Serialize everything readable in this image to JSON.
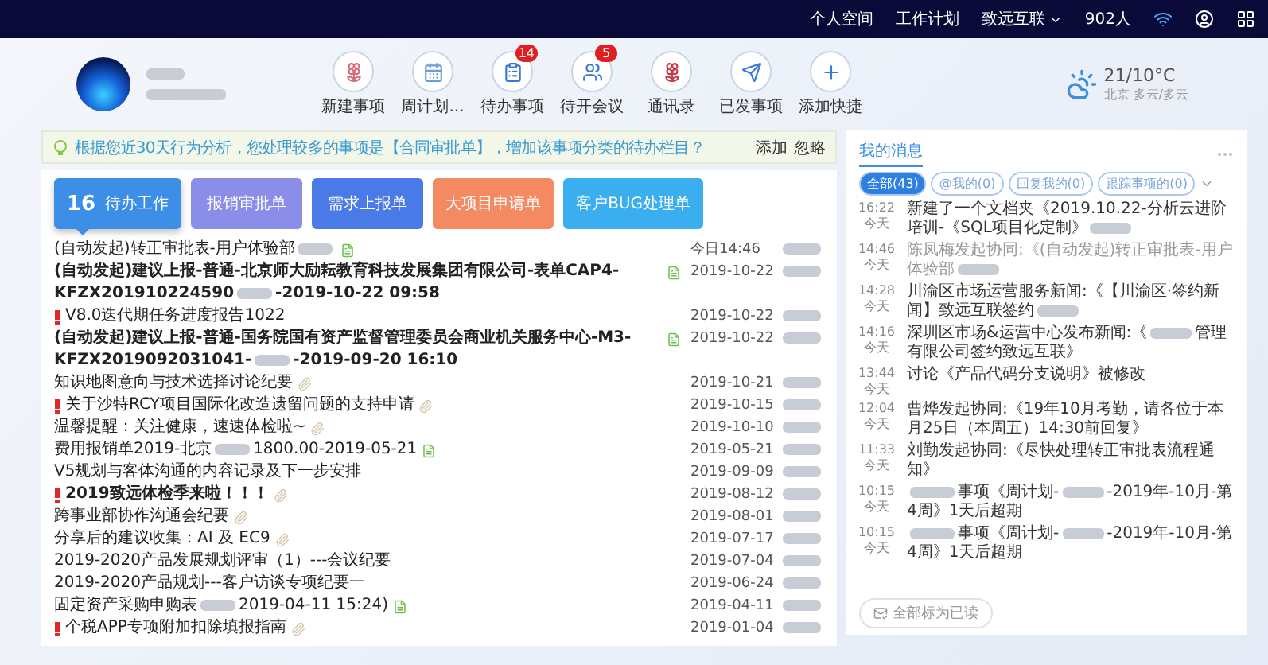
{
  "top_nav": {
    "links": [
      {
        "label": "个人空间",
        "dropdown": false
      },
      {
        "label": "工作计划",
        "dropdown": false
      },
      {
        "label": "致远互联",
        "dropdown": true
      }
    ],
    "online_count": "902人"
  },
  "profile": {
    "shortcuts": [
      {
        "label": "新建事项"
      },
      {
        "label": "周计划..."
      },
      {
        "label": "待办事项",
        "badge": "14"
      },
      {
        "label": "待开会议",
        "badge": "5"
      },
      {
        "label": "通讯录"
      },
      {
        "label": "已发事项"
      },
      {
        "label": "添加快捷"
      }
    ]
  },
  "weather": {
    "temperature": "21/10°C",
    "place": "北京 多云/多云"
  },
  "suggestion": {
    "text": "根据您近30天行为分析，您处理较多的事项是【合同审批单】，增加该事项分类的待办栏目？",
    "actions": [
      "添加",
      "忽略"
    ]
  },
  "tabs": [
    {
      "count": "16",
      "label": "待办工作",
      "selected": true,
      "color": "#3d8ee6"
    },
    {
      "label": "报销审批单",
      "selected": false,
      "color": "#8b8ee8"
    },
    {
      "label": "需求上报单",
      "selected": false,
      "color": "#4a79e8"
    },
    {
      "label": "大项目申请单",
      "selected": false,
      "color": "#f48a62"
    },
    {
      "label": "客户BUG处理单",
      "selected": false,
      "color": "#3aaeee"
    }
  ],
  "rows": [
    {
      "title": "(自动发起)转正审批表-用户体验部",
      "redacted": true,
      "bold": false,
      "urgent": false,
      "document": true,
      "attachment": false,
      "date": "今日14:46"
    },
    {
      "title": "(自动发起)建议上报-普通-北京师大励耘教育科技发展集团有限公司-表单CAP4-KFZX201910224590",
      "redacted": true,
      "title_after": "-2019-10-22 09:58",
      "bold": true,
      "urgent": false,
      "document": true,
      "attachment": false,
      "date": "2019-10-22"
    },
    {
      "title": "V8.0迭代期任务进度报告1022",
      "redacted": false,
      "bold": false,
      "urgent": true,
      "document": false,
      "attachment": false,
      "date": "2019-10-22"
    },
    {
      "title": "(自动发起)建议上报-普通-国务院国有资产监督管理委员会商业机关服务中心-M3-KFZX2019092031041-",
      "redacted": true,
      "title_after": "-2019-09-20 16:10",
      "bold": true,
      "urgent": false,
      "document": true,
      "attachment": false,
      "date": "2019-10-22"
    },
    {
      "title": "知识地图意向与技术选择讨论纪要",
      "redacted": false,
      "bold": false,
      "urgent": false,
      "document": false,
      "attachment": true,
      "date": "2019-10-21"
    },
    {
      "title": "关于沙特RCY项目国际化改造遗留问题的支持申请",
      "redacted": false,
      "bold": false,
      "urgent": true,
      "document": false,
      "attachment": true,
      "date": "2019-10-15"
    },
    {
      "title": "温馨提醒：关注健康，速速体检啦~",
      "redacted": false,
      "bold": false,
      "urgent": false,
      "document": false,
      "attachment": true,
      "date": "2019-10-10"
    },
    {
      "title": "费用报销单2019-北京",
      "redacted": true,
      "title_after": "1800.00-2019-05-21",
      "bold": false,
      "urgent": false,
      "document": true,
      "attachment": false,
      "date": "2019-05-21"
    },
    {
      "title": "V5规划与客体沟通的内容记录及下一步安排",
      "redacted": false,
      "bold": false,
      "urgent": false,
      "document": false,
      "attachment": false,
      "date": "2019-09-09"
    },
    {
      "title": "2019致远体检季来啦！！！",
      "redacted": false,
      "bold": true,
      "urgent": true,
      "document": false,
      "attachment": true,
      "date": "2019-08-12"
    },
    {
      "title": "跨事业部协作沟通会纪要",
      "redacted": false,
      "bold": false,
      "urgent": false,
      "document": false,
      "attachment": true,
      "date": "2019-08-01"
    },
    {
      "title": "分享后的建议收集：AI 及 EC9",
      "redacted": false,
      "bold": false,
      "urgent": false,
      "document": false,
      "attachment": true,
      "date": "2019-07-17"
    },
    {
      "title": "2019-2020产品发展规划评审（1）---会议纪要",
      "redacted": false,
      "bold": false,
      "urgent": false,
      "document": false,
      "attachment": false,
      "date": "2019-07-04"
    },
    {
      "title": "2019-2020产品规划---客户访谈专项纪要一",
      "redacted": false,
      "bold": false,
      "urgent": false,
      "document": false,
      "attachment": false,
      "date": "2019-06-24"
    },
    {
      "title": "固定资产采购申购表",
      "redacted": true,
      "title_after": "2019-04-11 15:24)",
      "bold": false,
      "urgent": false,
      "document": true,
      "attachment": false,
      "date": "2019-04-11"
    },
    {
      "title": "个税APP专项附加扣除填报指南",
      "redacted": false,
      "bold": false,
      "urgent": true,
      "document": false,
      "attachment": true,
      "date": "2019-01-04"
    }
  ],
  "messages": {
    "title": "我的消息",
    "filters": [
      {
        "label": "全部(43)",
        "selected": true
      },
      {
        "label": "@我的(0)",
        "selected": false
      },
      {
        "label": "回复我的(0)",
        "selected": false
      },
      {
        "label": "跟踪事项的(0)",
        "selected": false
      }
    ],
    "items": [
      {
        "time": "16:22",
        "day": "今天",
        "text": "新建了一个文档夹《2019.10.22-分析云进阶培训-《SQL项目化定制》",
        "redacted_before": false,
        "redacted_after": true,
        "read": false
      },
      {
        "time": "14:46",
        "day": "今天",
        "text": "陈凤梅发起协同:《(自动发起)转正审批表-用户体验部",
        "redacted_before": false,
        "redacted_after": true,
        "read": true
      },
      {
        "time": "14:28",
        "day": "今天",
        "text": "川渝区市场运营服务新闻:《【川渝区·签约新闻】致远互联签约",
        "redacted_before": false,
        "redacted_after": true,
        "read": false
      },
      {
        "time": "14:16",
        "day": "今天",
        "text": "深圳区市场&运营中心发布新闻:《",
        "redacted_before": false,
        "redacted_after": true,
        "text_after": "管理有限公司签约致远互联》",
        "read": false
      },
      {
        "time": "13:44",
        "day": "今天",
        "text": "讨论《产品代码分支说明》被修改",
        "redacted_before": false,
        "redacted_after": false,
        "read": false
      },
      {
        "time": "12:04",
        "day": "今天",
        "text": "曹烨发起协同:《19年10月考勤，请各位于本月25日（本周五）14:30前回复》",
        "redacted_before": false,
        "redacted_after": false,
        "read": false
      },
      {
        "time": "11:33",
        "day": "今天",
        "text": "刘勤发起协同:《尽快处理转正审批表流程通知》",
        "redacted_before": false,
        "redacted_after": false,
        "read": false
      },
      {
        "time": "10:15",
        "day": "今天",
        "redacted_before": true,
        "text": "事项《周计划-",
        "redacted_after": true,
        "text_after": "-2019年-10月-第4周》1天后超期",
        "read": false
      },
      {
        "time": "10:15",
        "day": "今天",
        "redacted_before": true,
        "text": "事项《周计划-",
        "redacted_after": true,
        "text_after": "-2019年-10月-第4周》1天后超期",
        "read": false
      }
    ],
    "footer_action": "全部标为已读"
  }
}
